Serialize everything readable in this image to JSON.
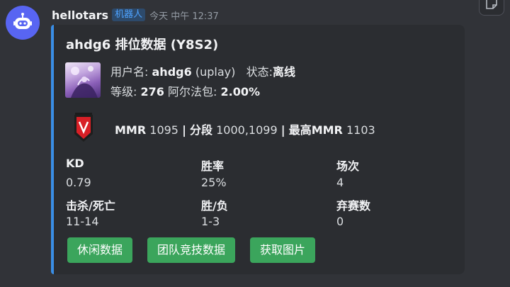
{
  "message": {
    "username": "hellotars",
    "bot_tag": "机器人",
    "timestamp": "今天 中午 12:37"
  },
  "embed": {
    "accent_color": "#3a8ee6",
    "title": "ahdg6 排位数据 (Y8S2)",
    "profile": {
      "username_label": "用户名:",
      "username_value": "ahdg6",
      "platform": "(uplay)",
      "status_label": "状态:",
      "status_value": "离线",
      "level_label": "等级:",
      "level_value": "276",
      "alpha_label": "阿尔法包:",
      "alpha_value": "2.00%"
    },
    "mmr": {
      "mmr_label": "MMR",
      "mmr_value": "1095",
      "sep1": "|",
      "segment_label": "分段",
      "segment_value": "1000,1099",
      "sep2": "|",
      "max_label": "最高MMR",
      "max_value": "1103",
      "rank_icon": "rank-badge-icon"
    },
    "stats": [
      {
        "label": "KD",
        "value": "0.79"
      },
      {
        "label": "胜率",
        "value": "25%"
      },
      {
        "label": "场次",
        "value": "4"
      },
      {
        "label": "击杀/死亡",
        "value": "11-14"
      },
      {
        "label": "胜/负",
        "value": "1-3"
      },
      {
        "label": "弃赛数",
        "value": "0"
      }
    ],
    "buttons": [
      {
        "label": "休闲数据",
        "color": "#3ba55c"
      },
      {
        "label": "团队竞技数据",
        "color": "#3ba55c"
      },
      {
        "label": "获取图片",
        "color": "#3ba55c"
      }
    ]
  }
}
